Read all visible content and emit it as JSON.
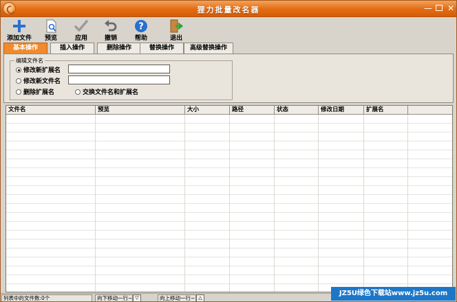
{
  "window": {
    "title": "狸力批量改名器"
  },
  "toolbar": {
    "buttons": [
      {
        "label": "添加文件",
        "icon": "add-icon"
      },
      {
        "label": "预览",
        "icon": "preview-icon"
      },
      {
        "label": "应用",
        "icon": "check-icon"
      },
      {
        "label": "撤销",
        "icon": "undo-icon"
      },
      {
        "label": "帮助",
        "icon": "help-icon"
      },
      {
        "label": "退出",
        "icon": "exit-icon"
      }
    ]
  },
  "tabs": [
    {
      "label": "基本操作",
      "active": true
    },
    {
      "label": "插入操作",
      "active": false
    },
    {
      "label": "删除操作",
      "active": false
    },
    {
      "label": "替换操作",
      "active": false
    },
    {
      "label": "高级替换操作",
      "active": false
    }
  ],
  "basic_panel": {
    "group_title": "编辑文件名",
    "options": [
      {
        "label": "修改新扩展名",
        "checked": true,
        "value": ""
      },
      {
        "label": "修改新文件名",
        "checked": false,
        "value": ""
      },
      {
        "label": "删除扩展名",
        "checked": false
      },
      {
        "label": "交换文件名和扩展名",
        "checked": false
      }
    ]
  },
  "table": {
    "columns": [
      "文件名",
      "预览",
      "大小",
      "路径",
      "状态",
      "修改日期",
      "扩展名"
    ],
    "rows": []
  },
  "status": {
    "file_count": "列表中的文件数:0个",
    "move_down": "向下移动一行~",
    "move_up": "向上移动一行~"
  },
  "watermark": "JZ5U绿色下载站www.jz5u.com",
  "colors": {
    "accent": "#e26b12",
    "watermark_bg": "#1d77c9"
  }
}
